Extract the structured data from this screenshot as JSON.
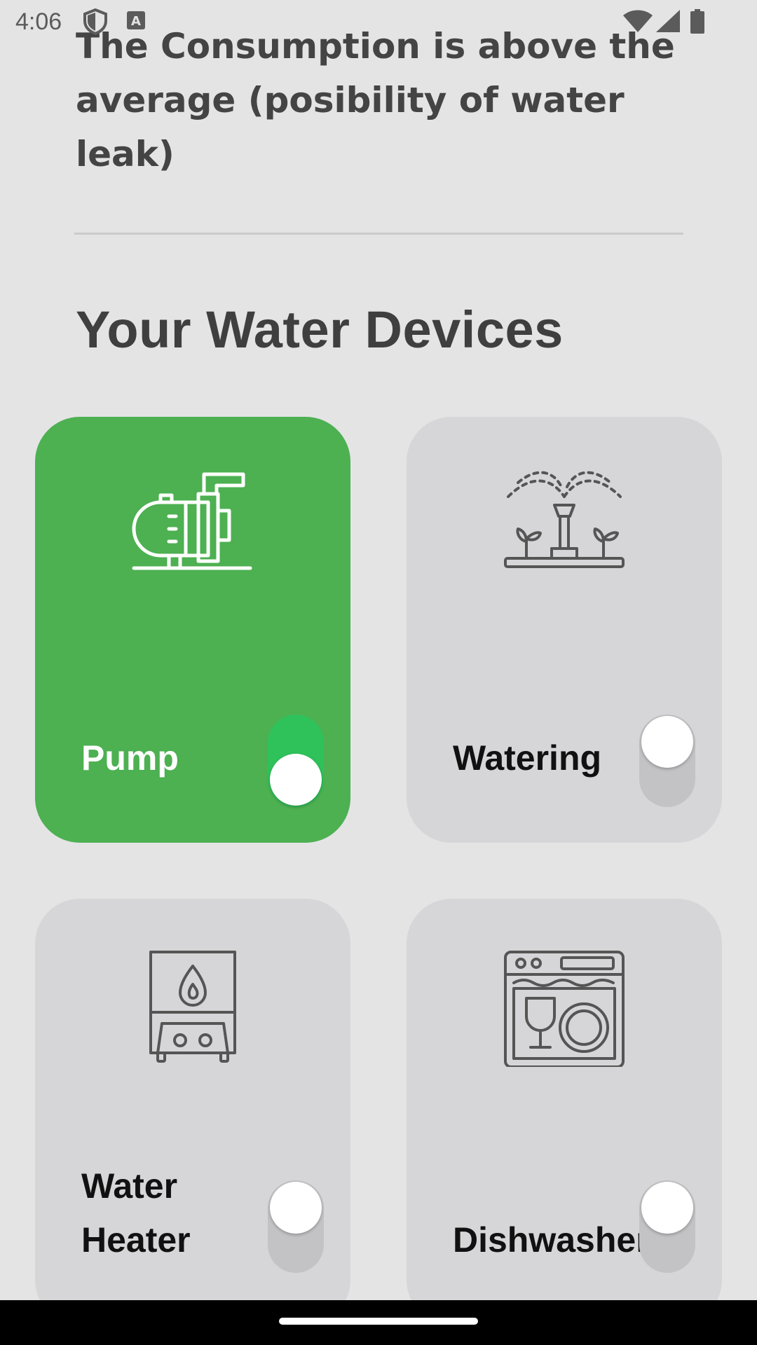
{
  "status_bar": {
    "time": "4:06",
    "icons": [
      "shield-icon",
      "keyboard-a-icon",
      "wifi-icon",
      "signal-icon",
      "battery-icon"
    ]
  },
  "alert": {
    "message": "The Consumption is above the average (posibility of water leak)"
  },
  "devices_section": {
    "title": "Your Water Devices"
  },
  "devices": [
    {
      "label": "Pump",
      "icon": "pump-icon",
      "on": true
    },
    {
      "label": "Watering",
      "icon": "sprinkler-icon",
      "on": false
    },
    {
      "label": "Water Heater",
      "icon": "water-heater-icon",
      "on": false
    },
    {
      "label": "Dishwasher",
      "icon": "dishwasher-icon",
      "on": false
    }
  ],
  "colors": {
    "background": "#e4e4e5",
    "card_on": "#4db051",
    "card_off": "#d6d6d8",
    "toggle_on": "#2fc25a",
    "toggle_off": "#c3c3c6"
  }
}
